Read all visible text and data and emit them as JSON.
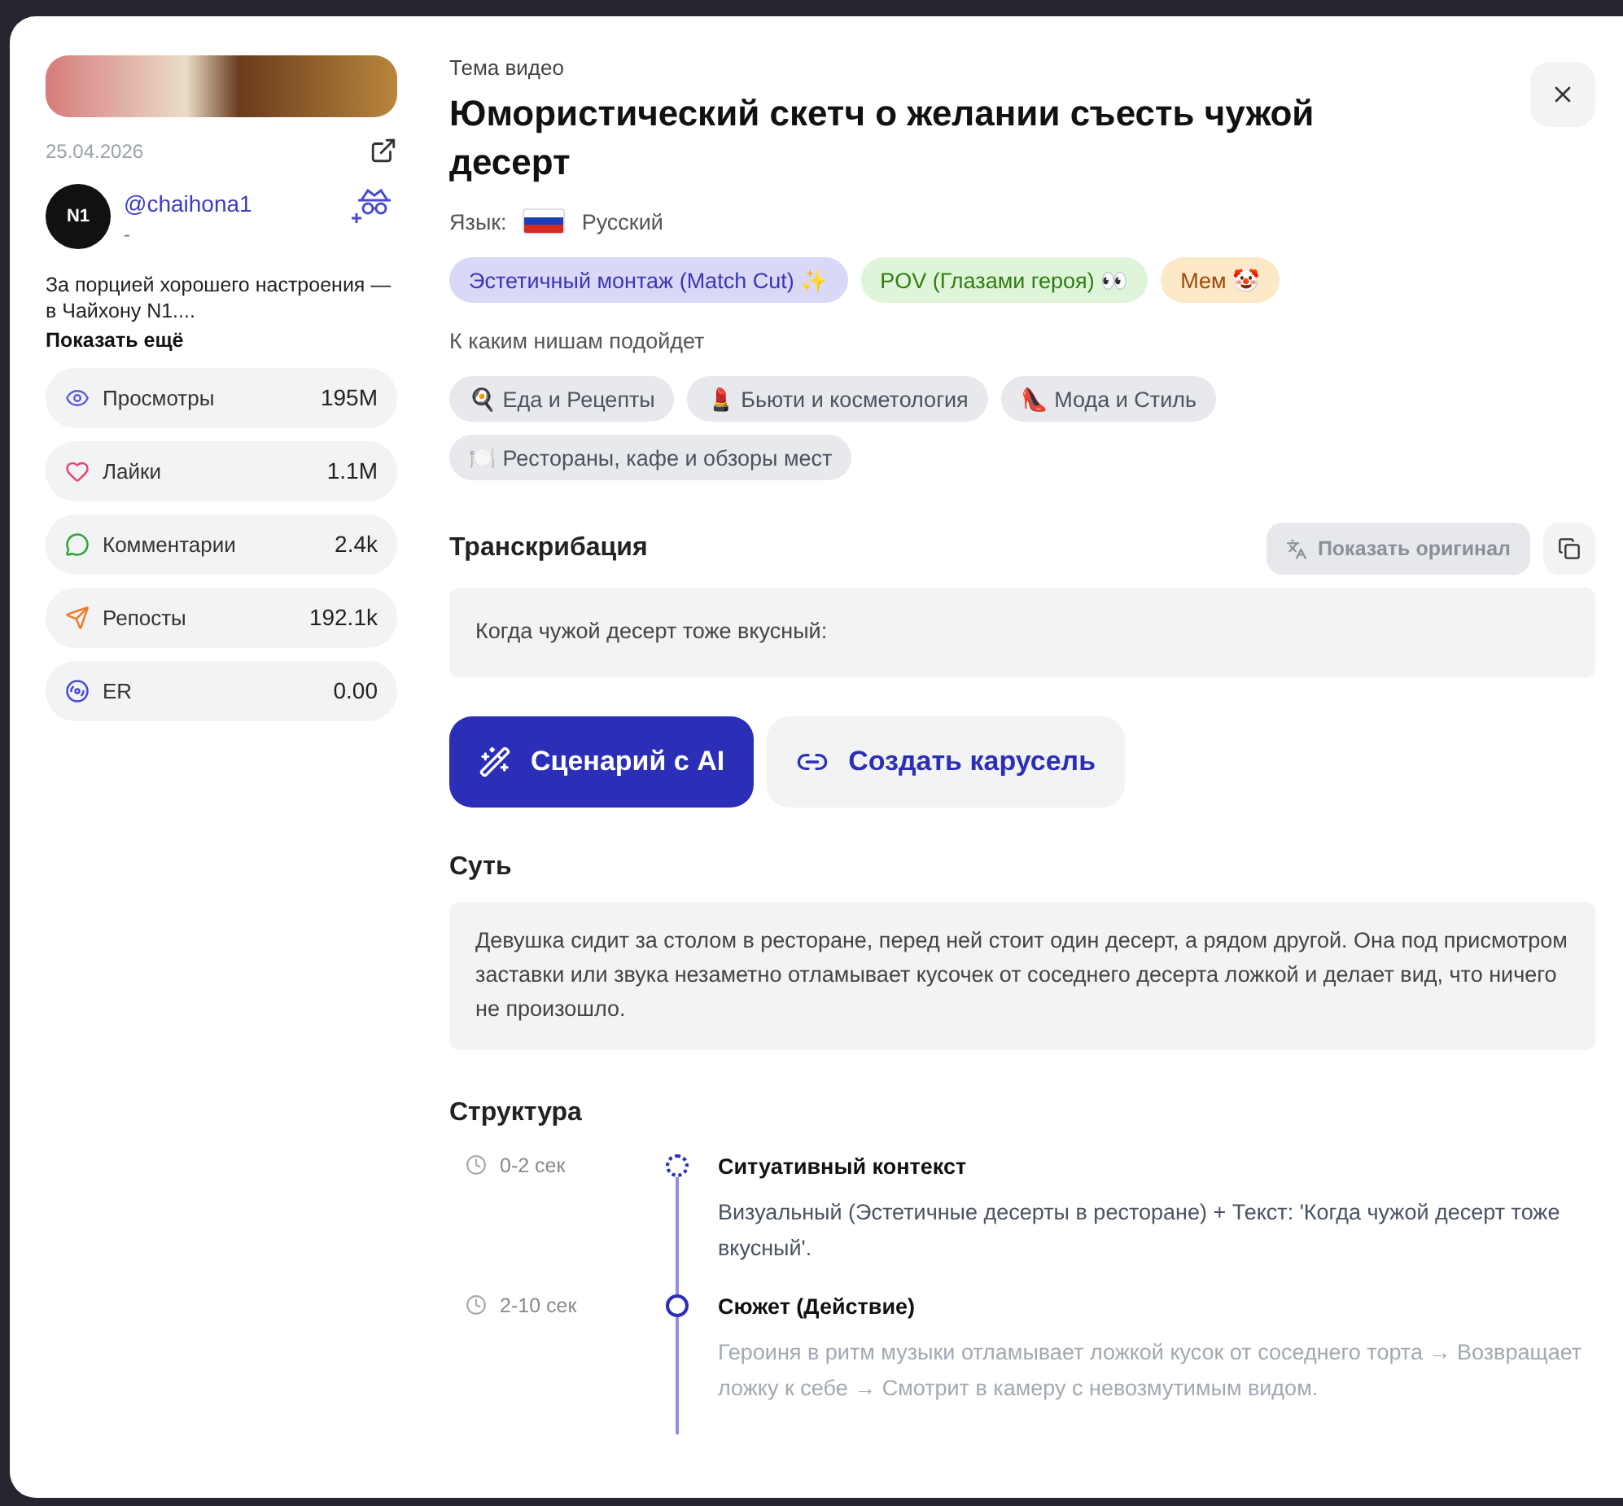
{
  "sidebar": {
    "date": "25.04.2026",
    "author": {
      "handle": "@chaihona1",
      "subtitle": "-",
      "logo_text": "N1"
    },
    "description": "За порцией хорошего настроения — в Чайхону N1....",
    "show_more": "Показать ещё",
    "stats": [
      {
        "kind": "views",
        "label": "Просмотры",
        "value": "195M",
        "color": "#5b5bd6"
      },
      {
        "kind": "likes",
        "label": "Лайки",
        "value": "1.1M",
        "color": "#e5486f"
      },
      {
        "kind": "comments",
        "label": "Комментарии",
        "value": "2.4k",
        "color": "#2fa52f"
      },
      {
        "kind": "reposts",
        "label": "Репосты",
        "value": "192.1k",
        "color": "#f07a2a"
      },
      {
        "kind": "er",
        "label": "ER",
        "value": "0.00",
        "color": "#4a4ad0"
      }
    ]
  },
  "main": {
    "caption": "Тема видео",
    "title": "Юмористический скетч о желании съесть чужой десерт",
    "language_label": "Язык:",
    "language": "Русский",
    "formats": [
      {
        "label": "Эстетичный монтаж (Match Cut) ✨",
        "color": "#d9d8f7"
      },
      {
        "label": "POV (Глазами героя) 👀",
        "color": "#dff5d9"
      },
      {
        "label": "Мем 🤡",
        "color": "#fde8c8"
      }
    ],
    "niches_label": "К каким нишам подойдет",
    "niches": [
      "🍳 Еда и Рецепты",
      "💄 Бьюти и косметология",
      "👠 Мода и Стиль",
      "🍽️ Рестораны, кафе и обзоры мест"
    ],
    "transcription": {
      "title": "Транскрибация",
      "show_original": {
        "label": "Показать оригинал",
        "disabled": true
      },
      "text": "Когда чужой десерт тоже вкусный:"
    },
    "actions": [
      {
        "kind": "primary",
        "label": "Сценарий с AI"
      },
      {
        "kind": "secondary",
        "label": "Создать карусель"
      }
    ],
    "essence": {
      "title": "Суть",
      "text": "Девушка сидит за столом в ресторане, перед ней стоит один десерт, а рядом другой. Она под присмотром заставки или звука незаметно отламывает кусочек от соседнего десерта ложкой и делает вид, что ничего не произошло."
    },
    "structure": {
      "title": "Структура",
      "steps": [
        {
          "time": "0-2 сек",
          "kind": "dotted",
          "title": "Ситуативный контекст",
          "text": "Визуальный (Эстетичные десерты в ресторане) + Текст: 'Когда чужой десерт тоже вкусный'.",
          "faded": false
        },
        {
          "time": "2-10 сек",
          "kind": "solid",
          "title": "Сюжет (Действие)",
          "text": "Героиня в ритм музыки отламывает ложкой кусок от соседнего торта → Возвращает ложку к себе → Смотрит в камеру с невозмутимым видом.",
          "faded": true
        }
      ]
    }
  }
}
